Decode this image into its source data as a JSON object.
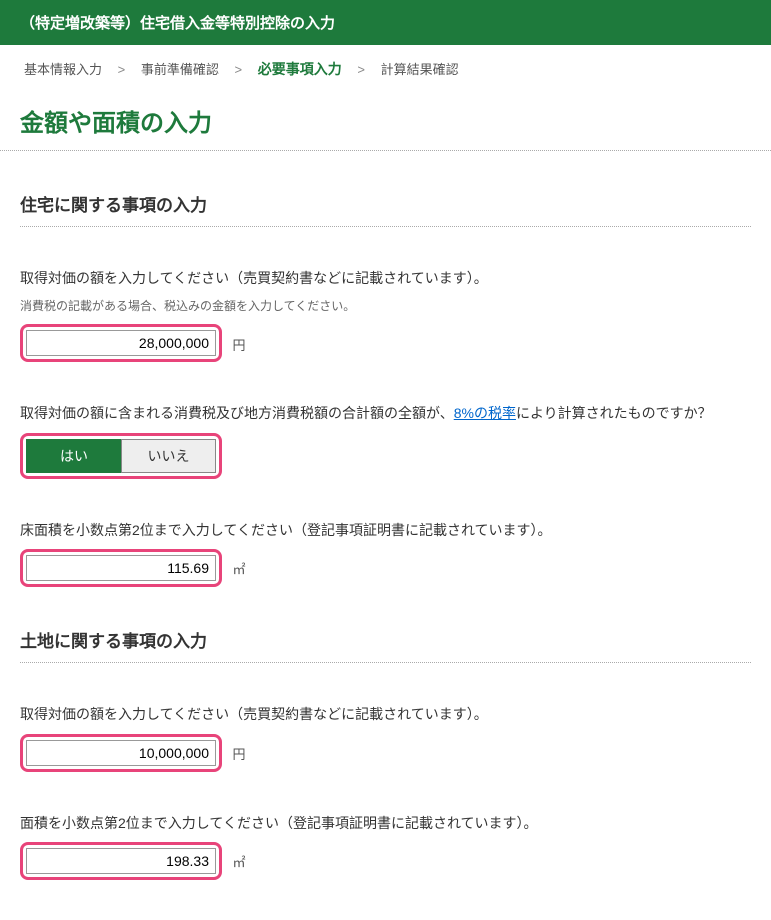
{
  "header": {
    "title": "（特定増改築等）住宅借入金等特別控除の入力"
  },
  "breadcrumb": {
    "items": [
      "基本情報入力",
      "事前準備確認",
      "必要事項入力",
      "計算結果確認"
    ],
    "current_index": 2
  },
  "page_title": "金額や面積の入力",
  "sections": {
    "house": {
      "heading": "住宅に関する事項の入力",
      "price": {
        "label": "取得対価の額を入力してください（売買契約書などに記載されています）。",
        "note": "消費税の記載がある場合、税込みの金額を入力してください。",
        "value": "28,000,000",
        "suffix": "円"
      },
      "tax_question": {
        "label_prefix": "取得対価の額に含まれる消費税及び地方消費税額の合計額の全額が、",
        "link_text": "8%の税率",
        "label_suffix": "により計算されたものですか？",
        "yes": "はい",
        "no": "いいえ",
        "selected": "yes"
      },
      "floor_area": {
        "label": "床面積を小数点第2位まで入力してください（登記事項証明書に記載されています）。",
        "value": "115.69",
        "suffix": "㎡"
      }
    },
    "land": {
      "heading": "土地に関する事項の入力",
      "price": {
        "label": "取得対価の額を入力してください（売買契約書などに記載されています）。",
        "value": "10,000,000",
        "suffix": "円"
      },
      "area": {
        "label": "面積を小数点第2位まで入力してください（登記事項証明書に記載されています）。",
        "value": "198.33",
        "suffix": "㎡"
      }
    }
  }
}
